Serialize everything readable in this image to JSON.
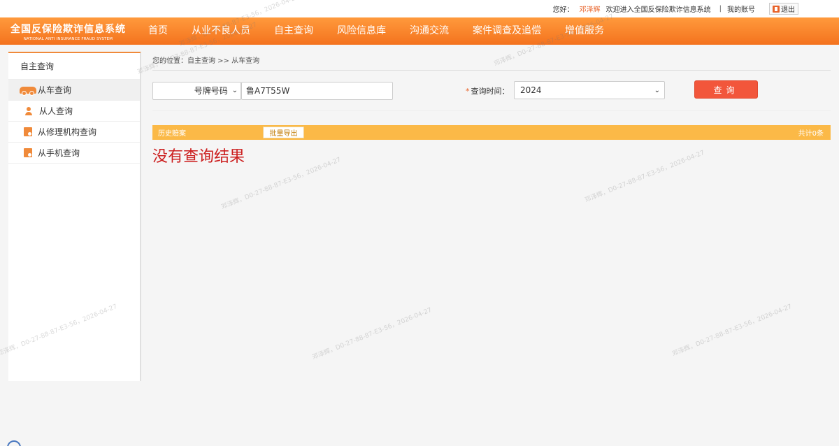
{
  "topbar": {
    "greeting": "您好：",
    "username": "邓泽辉",
    "welcome": "欢迎进入全国反保险欺诈信息系统",
    "separator": "|",
    "my_account": "我的账号",
    "logout": "退出"
  },
  "logo": {
    "cn": "全国反保险欺诈信息系统",
    "en": "NATIONAL ANTI INSURANCE FRAUD SYSTEM"
  },
  "nav": [
    "首页",
    "从业不良人员",
    "自主查询",
    "风险信息库",
    "沟通交流",
    "案件调查及追偿",
    "增值服务"
  ],
  "sidebar": {
    "title": "自主查询",
    "items": [
      {
        "label": "从车查询",
        "icon": "car-icon"
      },
      {
        "label": "从人查询",
        "icon": "person-icon"
      },
      {
        "label": "从修理机构查询",
        "icon": "repair-doc-icon"
      },
      {
        "label": "从手机查询",
        "icon": "phone-doc-icon"
      }
    ]
  },
  "breadcrumb": "您的位置：自主查询 >> 从车查询",
  "search": {
    "plate_type": "号牌号码",
    "plate_value": "鲁A7T55W",
    "required_mark": "*",
    "time_label": "查询时间：",
    "year": "2024",
    "query_button": "查询"
  },
  "results": {
    "tab_label": "历史赔案",
    "export_button": "批量导出",
    "total": "共计0条",
    "empty_message": "没有查询结果"
  },
  "watermark": "邓泽辉，D0-27-88-87-E3-56，2026-04-27",
  "colors": {
    "header_orange": "#f4721e",
    "accent_yellow": "#fbb947",
    "query_red": "#f2563b",
    "empty_red": "#cc1f1f"
  }
}
